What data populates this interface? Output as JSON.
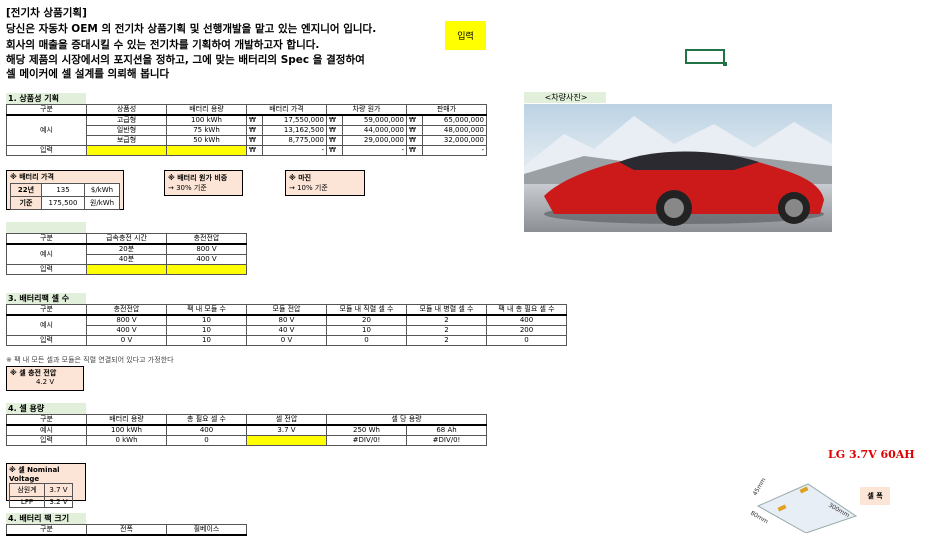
{
  "header": {
    "title": "[전기차 상품기획]",
    "lines": [
      "당신은 자동차 OEM 의 전기차 상품기획 및 선행개발을 맡고 있는 엔지니어 입니다.",
      "회사의 매출을 증대시킬 수 있는 전기차를 기획하여 개발하고자 합니다.",
      "해당 제품의 시장에서의 포지션을 정하고, 그에 맞는 배터리의 Spec 을 결정하여",
      "셀 메이커에 셀 설계를 의뢰해 봅니다"
    ]
  },
  "input_button": "입력",
  "car_photo_label": "<차량사진>",
  "s1": {
    "title": "1. 상품성 기획",
    "headers": [
      "구분",
      "상품성",
      "배터리 용량",
      "배터리 가격",
      "차량 원가",
      "판매가"
    ],
    "example_label": "예시",
    "input_label": "입력",
    "rows": [
      [
        "고급형",
        "100 kWh",
        "₩",
        "17,550,000",
        "₩",
        "59,000,000",
        "₩",
        "65,000,000"
      ],
      [
        "일반형",
        "75 kWh",
        "₩",
        "13,162,500",
        "₩",
        "44,000,000",
        "₩",
        "48,000,000"
      ],
      [
        "보급형",
        "50 kWh",
        "₩",
        "8,775,000",
        "₩",
        "29,000,000",
        "₩",
        "32,000,000"
      ]
    ],
    "input_row": [
      "₩",
      "-",
      "₩",
      "-",
      "₩",
      "-"
    ]
  },
  "price_box": {
    "title": "※ 배터리 가격",
    "r1": [
      "22년",
      "135",
      "$/kWh"
    ],
    "r2": [
      "기준",
      "175,500",
      "원/kWh"
    ]
  },
  "ratio_box": {
    "title": "※ 배터리 원가 비중",
    "text": "→ 30% 기준"
  },
  "margin_box": {
    "title": "※ 마진",
    "text": "→ 10% 기준"
  },
  "s2": {
    "headers": [
      "구분",
      "급속충전 시간",
      "충전전압"
    ],
    "example_label": "예시",
    "input_label": "입력",
    "rows": [
      [
        "20분",
        "800 V"
      ],
      [
        "40분",
        "400 V"
      ]
    ]
  },
  "s3": {
    "title": "3. 배터리팩 셀 수",
    "headers": [
      "구분",
      "충전전압",
      "팩 내 모듈 수",
      "모듈 전압",
      "모듈 내 직렬 셀 수",
      "모듈 내 병렬 셀 수",
      "팩 내 총 필요 셀 수"
    ],
    "example_label": "예시",
    "input_label": "입력",
    "rows": [
      [
        "800 V",
        "10",
        "80 V",
        "20",
        "2",
        "400"
      ],
      [
        "400 V",
        "10",
        "40 V",
        "10",
        "2",
        "200"
      ]
    ],
    "input_row": [
      "0 V",
      "10",
      "0 V",
      "0",
      "2",
      "0"
    ],
    "note": "※ 팩 내 모든 셀과 모듈은 직렬 연결되어 있다고 가정한다"
  },
  "cell_voltage_box": {
    "title": "※ 셀 충전 전압",
    "value": "4.2 V"
  },
  "s4": {
    "title": "4. 셀 용량",
    "headers": [
      "구분",
      "배터리 용량",
      "총 필요 셀 수",
      "셀 전압",
      "셀 당 용량"
    ],
    "example": [
      "예시",
      "100 kWh",
      "400",
      "3.7 V",
      "250 Wh",
      "68 Ah"
    ],
    "input": [
      "입력",
      "0 kWh",
      "0",
      "",
      "#DIV/0!",
      "#DIV/0!"
    ]
  },
  "nominal_box": {
    "title": "※ 셀 Nominal Voltage",
    "rows": [
      [
        "삼원계",
        "3.7 V"
      ],
      [
        "LFP",
        "3.2 V"
      ]
    ]
  },
  "s5": {
    "title": "4. 배터리 팩 크기",
    "headers": [
      "구분",
      "전폭",
      "휠베이스"
    ]
  },
  "lg_label": "LG  3.7V  60AH",
  "cell_width_label": "셀 폭",
  "dims": [
    "45mm",
    "300mm",
    "80mm"
  ],
  "colors": {
    "input": "#ffff00",
    "section": "#e2efda",
    "box": "#fce4d6",
    "car": "#cc1a1a"
  }
}
